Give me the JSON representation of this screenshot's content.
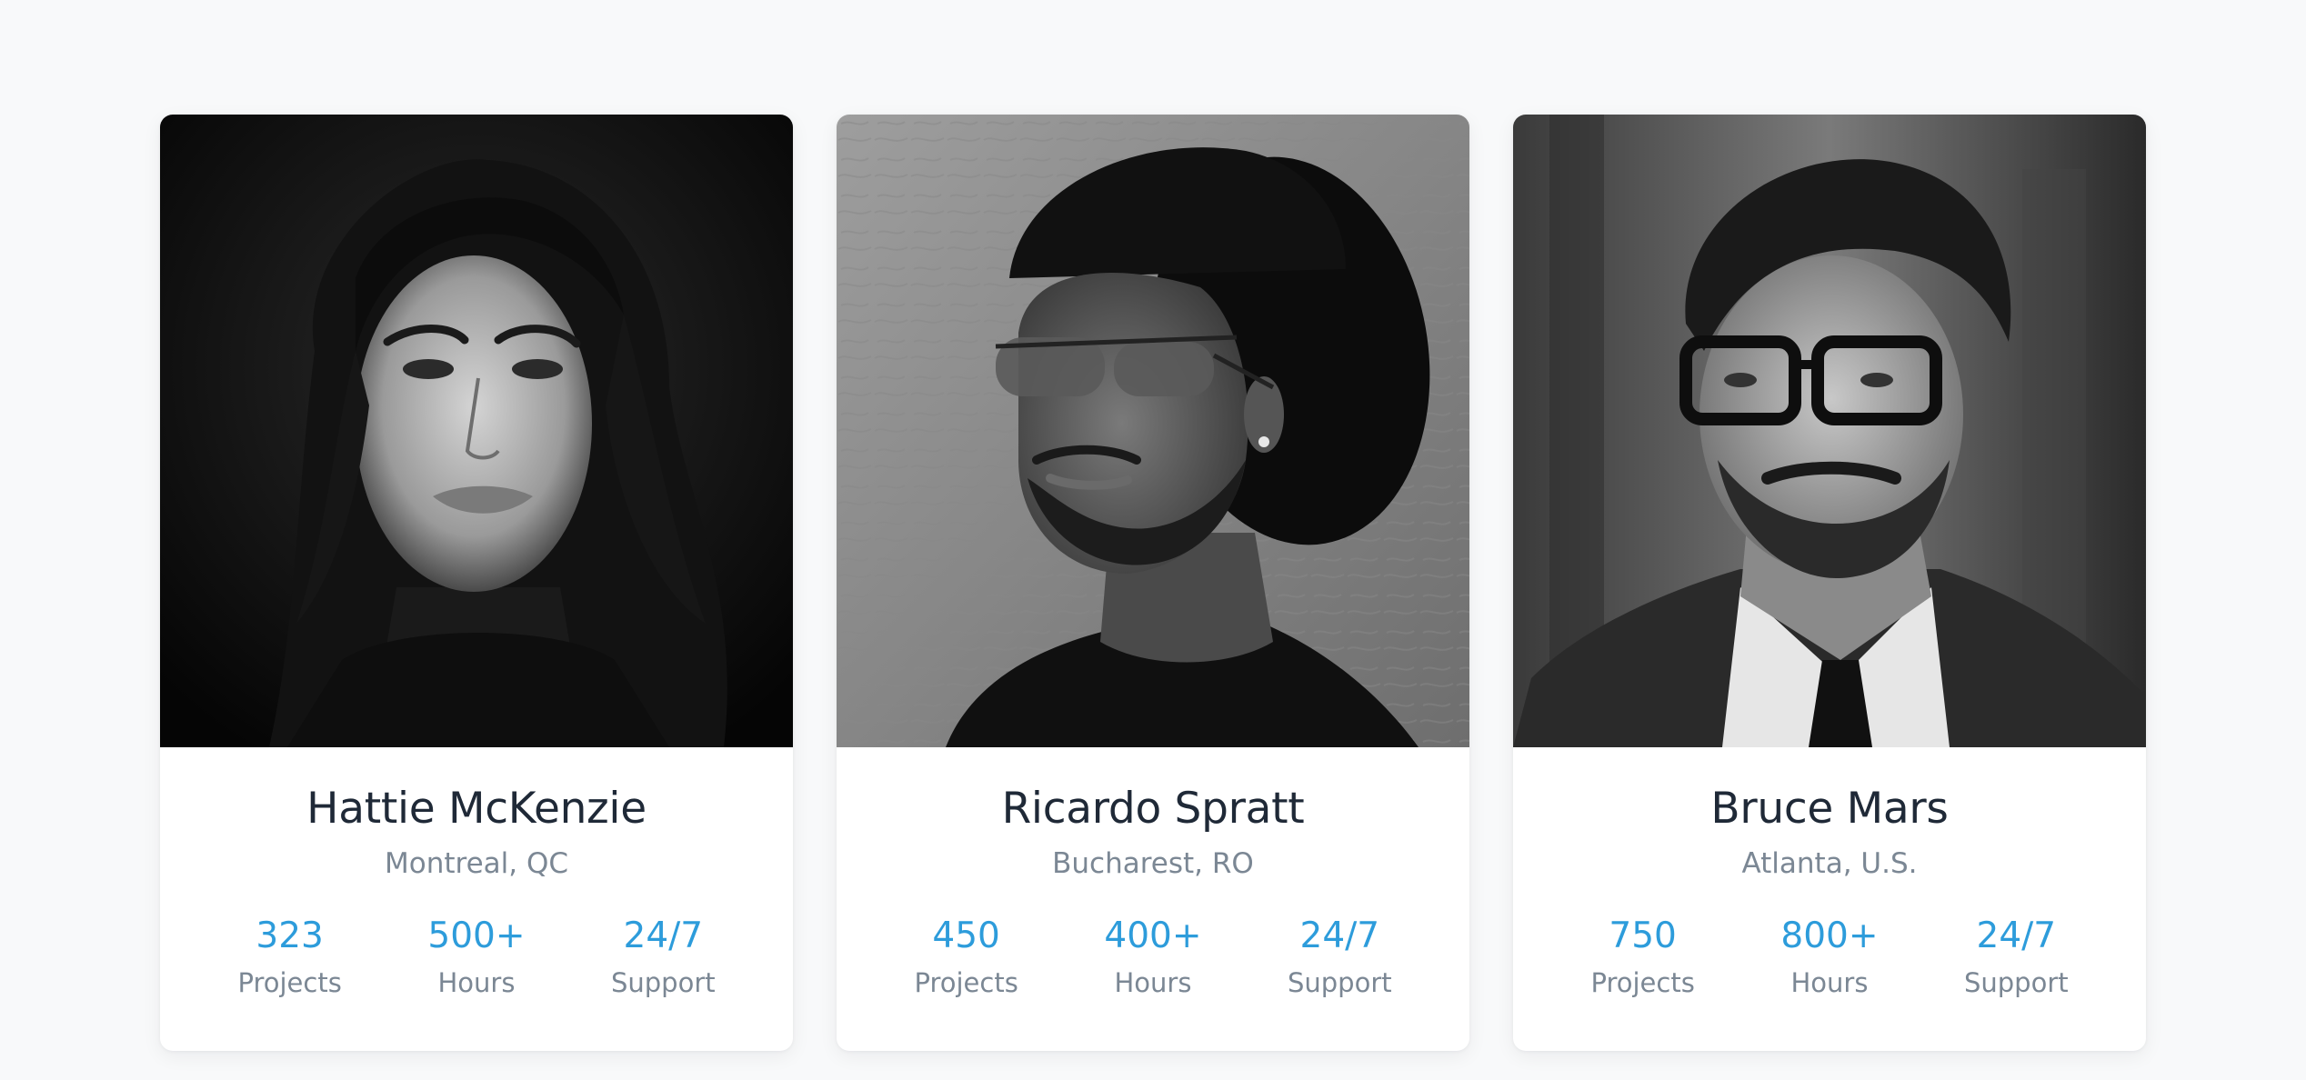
{
  "team": [
    {
      "name": "Hattie McKenzie",
      "location": "Montreal, QC",
      "photo": "portrait-photo-woman",
      "stats": [
        {
          "value": "323",
          "label": "Projects"
        },
        {
          "value": "500+",
          "label": "Hours"
        },
        {
          "value": "24/7",
          "label": "Support"
        }
      ]
    },
    {
      "name": "Ricardo Spratt",
      "location": "Bucharest, RO",
      "photo": "portrait-photo-man-hat",
      "stats": [
        {
          "value": "450",
          "label": "Projects"
        },
        {
          "value": "400+",
          "label": "Hours"
        },
        {
          "value": "24/7",
          "label": "Support"
        }
      ]
    },
    {
      "name": "Bruce Mars",
      "location": "Atlanta, U.S.",
      "photo": "portrait-photo-man-glasses",
      "stats": [
        {
          "value": "750",
          "label": "Projects"
        },
        {
          "value": "800+",
          "label": "Hours"
        },
        {
          "value": "24/7",
          "label": "Support"
        }
      ]
    }
  ],
  "colors": {
    "background": "#f8f9fa",
    "card": "#ffffff",
    "name": "#1f2937",
    "muted": "#7b8794",
    "accent": "#2d9cdb"
  }
}
